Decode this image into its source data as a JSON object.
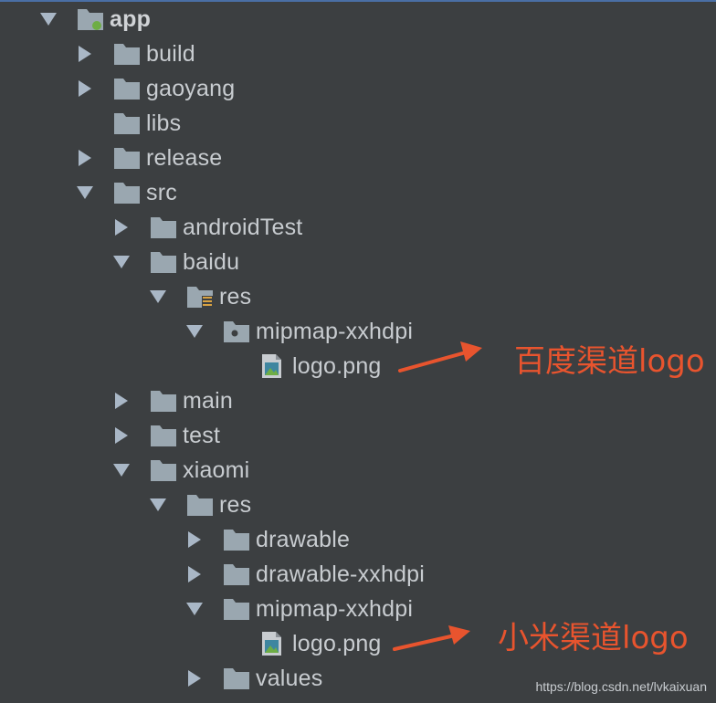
{
  "tree": {
    "app": "app",
    "build": "build",
    "gaoyang": "gaoyang",
    "libs": "libs",
    "release": "release",
    "src": "src",
    "androidTest": "androidTest",
    "baidu": "baidu",
    "baidu_res": "res",
    "baidu_mipmap": "mipmap-xxhdpi",
    "baidu_logo": "logo.png",
    "main": "main",
    "test": "test",
    "xiaomi": "xiaomi",
    "xiaomi_res": "res",
    "drawable": "drawable",
    "drawable_xxhdpi": "drawable-xxhdpi",
    "xiaomi_mipmap": "mipmap-xxhdpi",
    "xiaomi_logo": "logo.png",
    "values": "values"
  },
  "annotations": {
    "baidu_logo_note": "百度渠道logo",
    "xiaomi_logo_note": "小米渠道logo"
  },
  "watermark": "https://blog.csdn.net/lvkaixuan",
  "colors": {
    "background": "#3c3f41",
    "folder": "#9aa7b0",
    "text": "#c8ccd0",
    "annotation": "#e8542e",
    "module_dot": "#6ead45"
  }
}
